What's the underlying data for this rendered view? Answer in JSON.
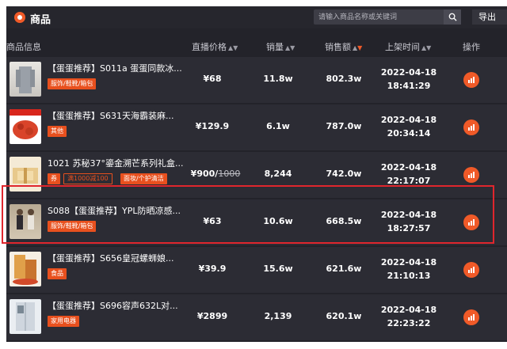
{
  "header": {
    "title": "商品",
    "search_placeholder": "请输入商品名称或关键词",
    "export_label": "导出"
  },
  "columns": {
    "info": "商品信息",
    "price": "直播价格",
    "sales": "销量",
    "amount": "销售额",
    "time": "上架时间",
    "action": "操作"
  },
  "colors": {
    "accent": "#f05a28",
    "highlight": "#e0262d",
    "row_bg": "#2c2c34"
  },
  "rows": [
    {
      "title": "【蛋蛋推荐】S011a 蛋蛋同款冰...",
      "tags": [
        "服饰/鞋靴/箱包"
      ],
      "price": "¥68",
      "sales": "11.8w",
      "amount": "802.3w",
      "date": "2022-04-18",
      "time": "18:41:29"
    },
    {
      "title": "【蛋蛋推荐】S631天海霸装麻...",
      "tags": [
        "其他"
      ],
      "price": "¥129.9",
      "sales": "6.1w",
      "amount": "787.0w",
      "date": "2022-04-18",
      "time": "20:34:14"
    },
    {
      "title": "1021 苏秘37°鎏金溯芒系列礼盒...",
      "tags": [
        "券",
        "满1000减100",
        "面妆/个护清洁"
      ],
      "price": "¥900",
      "price_original": "1000",
      "sales": "8,244",
      "amount": "742.0w",
      "date": "2022-04-18",
      "time": "22:17:07"
    },
    {
      "title": "S088【蛋蛋推荐】YPL防晒凉感...",
      "tags": [
        "服饰/鞋靴/箱包"
      ],
      "price": "¥63",
      "sales": "10.6w",
      "amount": "668.5w",
      "date": "2022-04-18",
      "time": "18:27:57"
    },
    {
      "title": "【蛋蛋推荐】S656皇冠螺蛳娘...",
      "tags": [
        "食品"
      ],
      "price": "¥39.9",
      "sales": "15.6w",
      "amount": "621.6w",
      "date": "2022-04-18",
      "time": "21:10:13"
    },
    {
      "title": "【蛋蛋推荐】S696容声632L对...",
      "tags": [
        "家用电器"
      ],
      "price": "¥2899",
      "sales": "2,139",
      "amount": "620.1w",
      "date": "2022-04-18",
      "time": "22:23:22"
    }
  ]
}
